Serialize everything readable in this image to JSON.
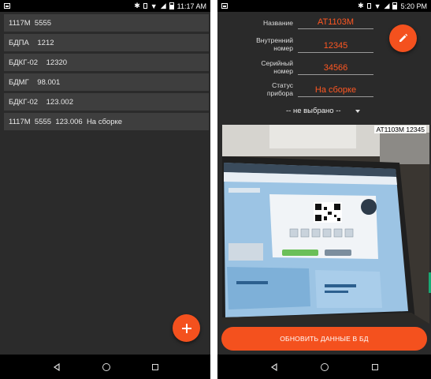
{
  "left_screen": {
    "status": {
      "time": "11:17 AM"
    },
    "items": [
      {
        "label": "1117M  5555"
      },
      {
        "label": "БДПА    1212"
      },
      {
        "label": "БДКГ-02    12320"
      },
      {
        "label": "БДМГ    98.001"
      },
      {
        "label": "БДКГ-02    123.002"
      },
      {
        "label": "1117M  5555  123.006  На сборке"
      }
    ],
    "fab": {
      "icon": "plus-icon",
      "glyph": "+"
    }
  },
  "right_screen": {
    "status": {
      "time": "5:20 PM"
    },
    "form": {
      "name_label": "Название",
      "name_value": "АТ1103М",
      "inner_label_line1": "Внутренний",
      "inner_label_line2": "номер",
      "inner_value": "12345",
      "serial_label_line1": "Серийный",
      "serial_label_line2": "номер",
      "serial_value": "34566",
      "status_label_line1": "Статус",
      "status_label_line2": "прибора",
      "status_value": "На сборке"
    },
    "dropdown": {
      "selected": "-- не выбрано --"
    },
    "photo": {
      "caption": "АТ1103М 12345"
    },
    "submit_label": "ОБНОВИТЬ ДАННЫЕ В БД",
    "edit_fab": {
      "icon": "pencil-icon"
    }
  },
  "colors": {
    "accent": "#f4511e",
    "background": "#2b2b2b",
    "list_item": "#3e3e3e",
    "text_accent": "#ff5722"
  }
}
